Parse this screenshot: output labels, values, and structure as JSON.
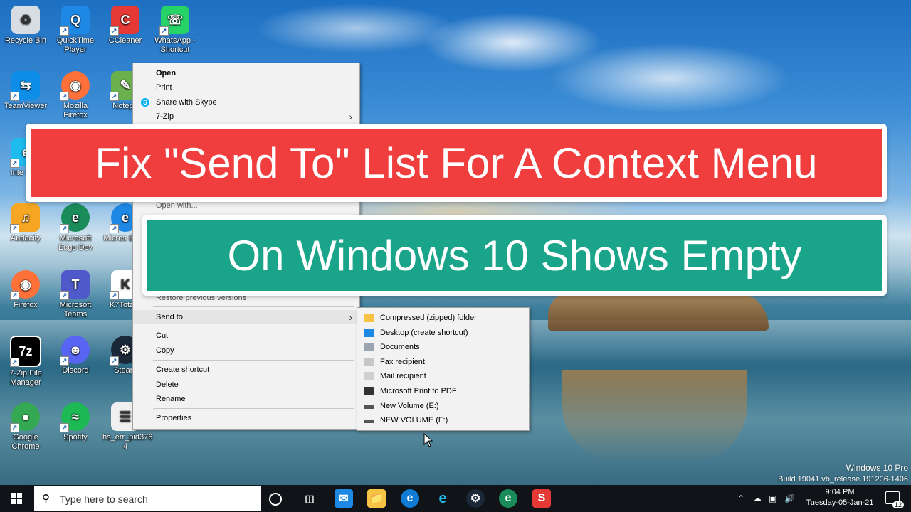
{
  "desktop_icons": [
    {
      "label": "Recycle Bin",
      "icon": "recycle-bin-icon",
      "color": "#d8dde4"
    },
    {
      "label": "QuickTime Player",
      "icon": "quicktime-icon",
      "color": "#1e88e5"
    },
    {
      "label": "CCleaner",
      "icon": "ccleaner-icon",
      "color": "#e53935"
    },
    {
      "label": "WhatsApp - Shortcut",
      "icon": "whatsapp-icon",
      "color": "#25d366"
    },
    {
      "label": "TeamViewer",
      "icon": "teamviewer-icon",
      "color": "#0e8ee9"
    },
    {
      "label": "Mozilla Firefox",
      "icon": "firefox-icon",
      "color": "#ff7139"
    },
    {
      "label": "Notepa",
      "icon": "notepad-icon",
      "color": "#6ab04c"
    },
    {
      "label": "Inte Expl",
      "icon": "internet-explorer-icon",
      "color": "#1ebbee"
    },
    {
      "label": "Audacity",
      "icon": "audacity-icon",
      "color": "#f5a623"
    },
    {
      "label": "Microsoft Edge Dev",
      "icon": "edge-dev-icon",
      "color": "#1a8c5a"
    },
    {
      "label": "Micros Edge",
      "icon": "edge-icon",
      "color": "#1e88e5"
    },
    {
      "label": "Firefox",
      "icon": "firefox-icon",
      "color": "#ff7139"
    },
    {
      "label": "Microsoft Teams",
      "icon": "teams-icon",
      "color": "#5059c9"
    },
    {
      "label": "K7TotalS",
      "icon": "k7-icon",
      "color": "#ffffff"
    },
    {
      "label": "7-Zip File Manager",
      "icon": "7zip-icon",
      "color": "#000000"
    },
    {
      "label": "Discord",
      "icon": "discord-icon",
      "color": "#5865f2"
    },
    {
      "label": "Steam",
      "icon": "steam-icon",
      "color": "#1b2838"
    },
    {
      "label": "Google Chrome",
      "icon": "chrome-icon",
      "color": "#34a853"
    },
    {
      "label": "Spotify",
      "icon": "spotify-icon",
      "color": "#1db954"
    },
    {
      "label": "hs_err_pid376 4",
      "icon": "text-file-icon",
      "color": "#f0f0f0"
    }
  ],
  "banner": {
    "line1": "Fix \"Send To\" List For A Context Menu",
    "line2": "On Windows 10 Shows Empty",
    "color1": "#f03d3d",
    "color2": "#1aa58a"
  },
  "context_menu": {
    "open": "Open",
    "print": "Print",
    "share_skype": "Share with Skype",
    "seven_zip": "7-Zip",
    "open_with": "Open with...",
    "restore": "Restore previous versions",
    "send_to": "Send to",
    "cut": "Cut",
    "copy": "Copy",
    "create_shortcut": "Create shortcut",
    "delete": "Delete",
    "rename": "Rename",
    "properties": "Properties"
  },
  "send_to_menu": [
    {
      "label": "Compressed (zipped) folder",
      "icon": "zip-folder-icon"
    },
    {
      "label": "Desktop (create shortcut)",
      "icon": "desktop-icon"
    },
    {
      "label": "Documents",
      "icon": "documents-icon"
    },
    {
      "label": "Fax recipient",
      "icon": "fax-icon"
    },
    {
      "label": "Mail recipient",
      "icon": "mail-icon"
    },
    {
      "label": "Microsoft Print to PDF",
      "icon": "printer-icon"
    },
    {
      "label": "New Volume (E:)",
      "icon": "drive-icon"
    },
    {
      "label": "NEW VOLUME (F:)",
      "icon": "drive-icon"
    }
  ],
  "taskbar": {
    "search_placeholder": "Type here to search",
    "time": "9:04 PM",
    "date": "Tuesday-05-Jan-21",
    "notification_count": "12"
  },
  "watermark": {
    "edition": "Windows 10 Pro",
    "build": "Build 19041.vb_release.191206-1406"
  }
}
